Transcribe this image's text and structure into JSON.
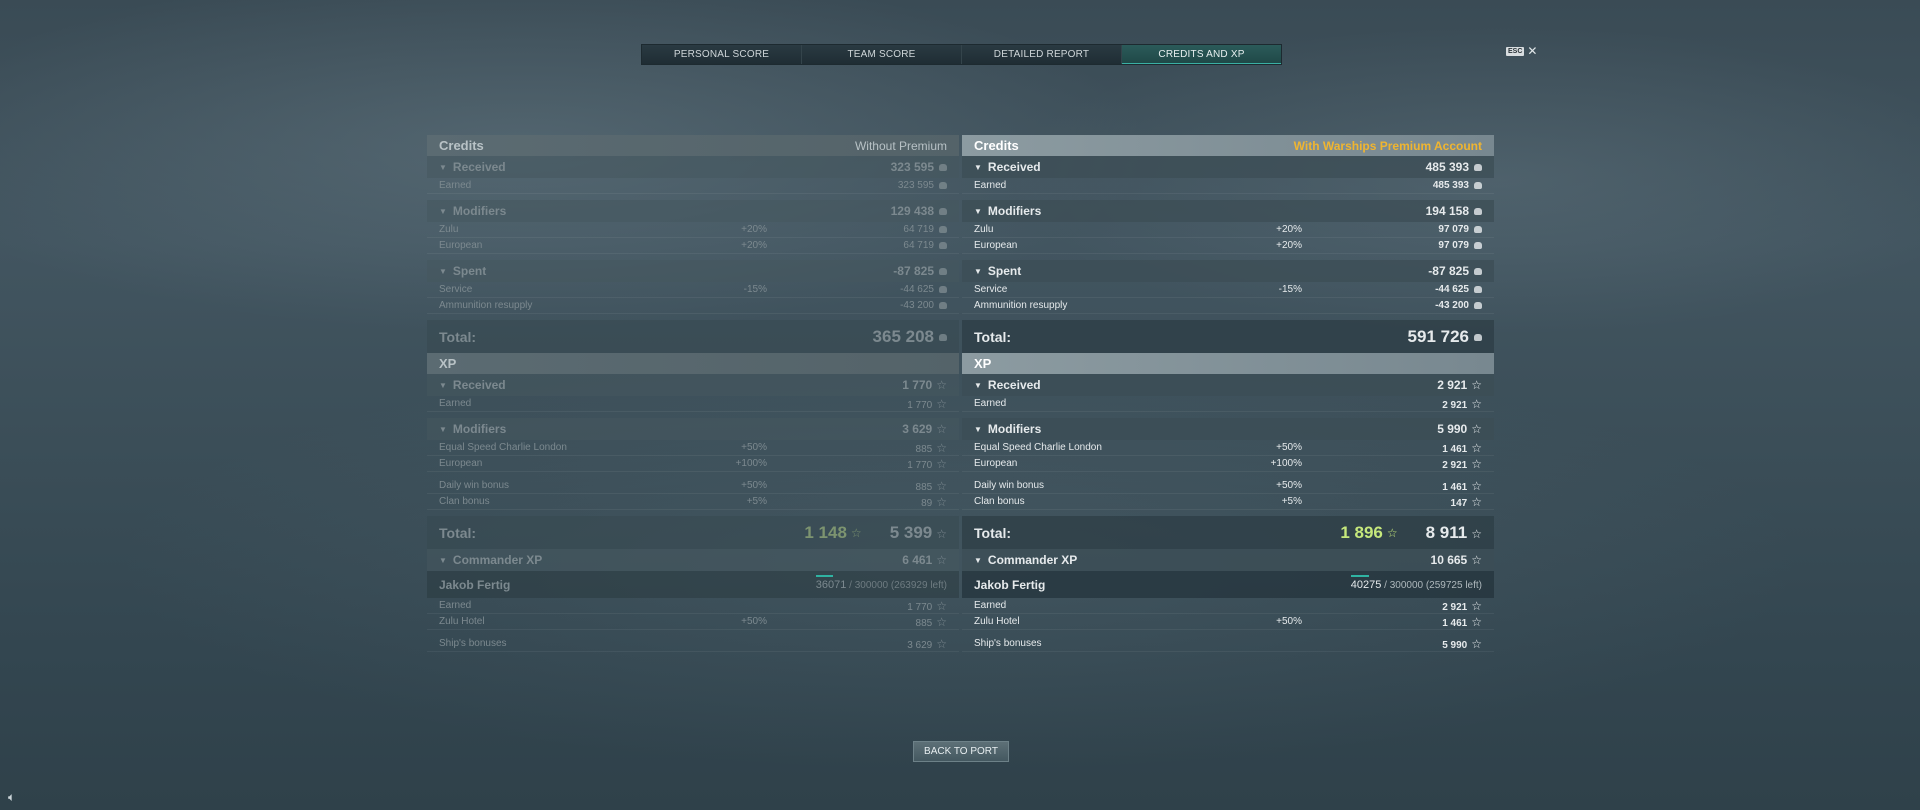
{
  "tabs": [
    {
      "label": "PERSONAL SCORE"
    },
    {
      "label": "TEAM SCORE"
    },
    {
      "label": "DETAILED REPORT"
    },
    {
      "label": "CREDITS AND XP",
      "active": true
    }
  ],
  "esc_label": "ESC",
  "close_glyph": "✕",
  "colors": {
    "premium": "#f0b530",
    "accent": "#2fb3a2",
    "free_xp": "#c6e87c"
  },
  "left": {
    "credits_title": "Credits",
    "mode": "Without Premium",
    "received": {
      "label": "Received",
      "value": "323 595"
    },
    "earned": {
      "label": "Earned",
      "value": "323 595"
    },
    "modifiers": {
      "label": "Modifiers",
      "value": "129 438"
    },
    "mods": [
      {
        "label": "Zulu",
        "pct": "+20%",
        "value": "64 719"
      },
      {
        "label": "European",
        "pct": "+20%",
        "value": "64 719"
      }
    ],
    "spent": {
      "label": "Spent",
      "value": "-87 825"
    },
    "spent_rows": [
      {
        "label": "Service",
        "pct": "-15%",
        "value": "-44 625"
      },
      {
        "label": "Ammunition resupply",
        "pct": "",
        "value": "-43 200"
      }
    ],
    "credits_total": {
      "label": "Total:",
      "value": "365 208"
    },
    "xp_title": "XP",
    "xp_received": {
      "label": "Received",
      "value": "1 770"
    },
    "xp_earned": {
      "label": "Earned",
      "value": "1 770"
    },
    "xp_modifiers": {
      "label": "Modifiers",
      "value": "3 629"
    },
    "xp_mods_a": [
      {
        "label": "Equal Speed Charlie London",
        "pct": "+50%",
        "value": "885"
      },
      {
        "label": "European",
        "pct": "+100%",
        "value": "1 770"
      }
    ],
    "xp_mods_b": [
      {
        "label": "Daily win bonus",
        "pct": "+50%",
        "value": "885"
      },
      {
        "label": "Clan bonus",
        "pct": "+5%",
        "value": "89"
      }
    ],
    "xp_total": {
      "label": "Total:",
      "free": "1 148",
      "value": "5 399"
    },
    "cmd": {
      "label": "Commander XP",
      "value": "6 461",
      "name": "Jakob Fertig",
      "current": "36071",
      "rest": "/ 300000 (263929 left)",
      "progress": 0.12
    },
    "cmd_rows": [
      {
        "label": "Earned",
        "pct": "",
        "value": "1 770"
      },
      {
        "label": "Zulu Hotel",
        "pct": "+50%",
        "value": "885"
      }
    ],
    "ship_bonuses": {
      "label": "Ship's bonuses",
      "value": "3 629"
    }
  },
  "right": {
    "credits_title": "Credits",
    "mode": "With Warships Premium Account",
    "received": {
      "label": "Received",
      "value": "485 393"
    },
    "earned": {
      "label": "Earned",
      "value": "485 393"
    },
    "modifiers": {
      "label": "Modifiers",
      "value": "194 158"
    },
    "mods": [
      {
        "label": "Zulu",
        "pct": "+20%",
        "value": "97 079"
      },
      {
        "label": "European",
        "pct": "+20%",
        "value": "97 079"
      }
    ],
    "spent": {
      "label": "Spent",
      "value": "-87 825"
    },
    "spent_rows": [
      {
        "label": "Service",
        "pct": "-15%",
        "value": "-44 625"
      },
      {
        "label": "Ammunition resupply",
        "pct": "",
        "value": "-43 200"
      }
    ],
    "credits_total": {
      "label": "Total:",
      "value": "591 726"
    },
    "xp_title": "XP",
    "xp_received": {
      "label": "Received",
      "value": "2 921"
    },
    "xp_earned": {
      "label": "Earned",
      "value": "2 921"
    },
    "xp_modifiers": {
      "label": "Modifiers",
      "value": "5 990"
    },
    "xp_mods_a": [
      {
        "label": "Equal Speed Charlie London",
        "pct": "+50%",
        "value": "1 461"
      },
      {
        "label": "European",
        "pct": "+100%",
        "value": "2 921"
      }
    ],
    "xp_mods_b": [
      {
        "label": "Daily win bonus",
        "pct": "+50%",
        "value": "1 461"
      },
      {
        "label": "Clan bonus",
        "pct": "+5%",
        "value": "147"
      }
    ],
    "xp_total": {
      "label": "Total:",
      "free": "1 896",
      "value": "8 911"
    },
    "cmd": {
      "label": "Commander XP",
      "value": "10 665",
      "name": "Jakob Fertig",
      "current": "40275",
      "rest": "/ 300000 (259725 left)",
      "progress": 0.13
    },
    "cmd_rows": [
      {
        "label": "Earned",
        "pct": "",
        "value": "2 921"
      },
      {
        "label": "Zulu Hotel",
        "pct": "+50%",
        "value": "1 461"
      }
    ],
    "ship_bonuses": {
      "label": "Ship's bonuses",
      "value": "5 990"
    }
  },
  "back_label": "BACK TO PORT",
  "speaker_icon": "speaker-icon"
}
